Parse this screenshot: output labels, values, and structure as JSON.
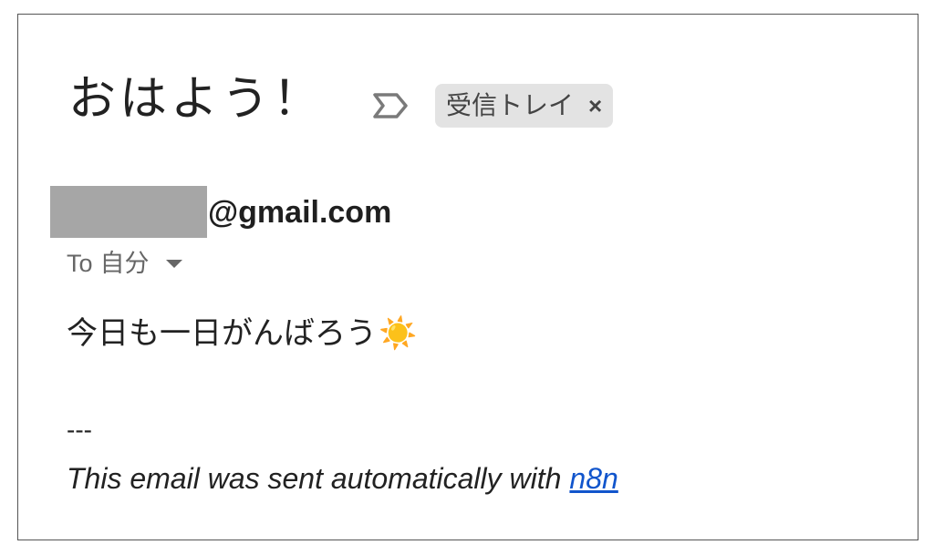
{
  "email": {
    "subject": "おはよう！",
    "labels": [
      {
        "label": "受信トレイ",
        "remove": "×"
      }
    ],
    "sender": {
      "address": "@gmail.com"
    },
    "recipient": {
      "prefix": "To",
      "name": "自分"
    },
    "body": {
      "text": "今日も一日がんばろう",
      "emoji": "☀️",
      "separator": "---",
      "footer_text": "This email was sent automatically with",
      "link_text": "n8n"
    }
  },
  "icons": {
    "importance": "important-marker-icon",
    "recipient_details": "caret-down-icon",
    "label_remove": "close-icon"
  },
  "colors": {
    "text": "#222222",
    "secondary_text": "#666666",
    "chip_background": "#e3e3e3",
    "redaction": "#a6a6a6",
    "link": "#1155cc",
    "emoji_sun": "#f5a623",
    "frame_border": "#555555"
  }
}
